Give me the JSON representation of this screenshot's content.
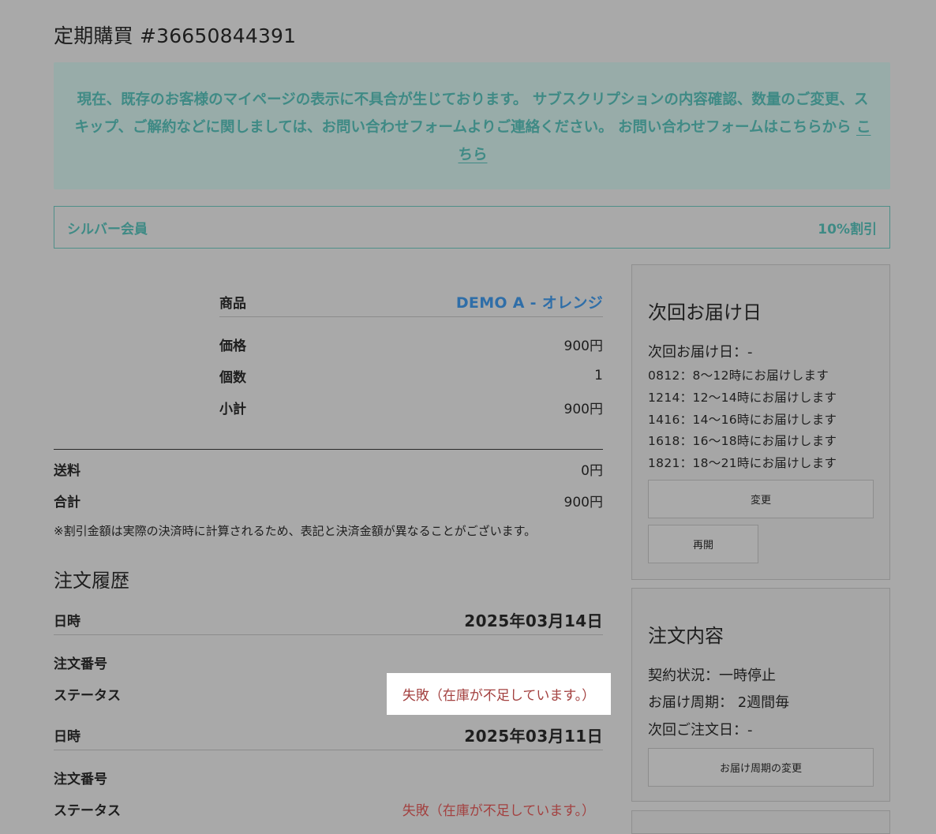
{
  "page": {
    "title": "定期購買 #36650844391"
  },
  "notice": {
    "text": "現在、既存のお客様のマイページの表示に不具合が生じております。 サブスクリプションの内容確認、数量のご変更、スキップ、ご解約などに関しましては、お問い合わせフォームよりご連絡ください。 お問い合わせフォームはこちらから",
    "link_label": "こちら"
  },
  "membership": {
    "tier": "シルバー会員",
    "discount": "10%割引"
  },
  "product": {
    "label": "商品",
    "name": "DEMO A - オレンジ",
    "price_label": "価格",
    "price": "900円",
    "qty_label": "個数",
    "qty": "1",
    "subtotal_label": "小計",
    "subtotal": "900円"
  },
  "totals": {
    "shipping_label": "送料",
    "shipping": "0円",
    "total_label": "合計",
    "total": "900円",
    "note": "※割引金額は実際の決済時に計算されるため、表記と決済金額が異なることがございます。"
  },
  "history": {
    "heading": "注文履歴",
    "entries": [
      {
        "date_label": "日時",
        "date": "2025年03月14日",
        "order_no_label": "注文番号",
        "order_no": "",
        "status_label": "ステータス",
        "status": "失敗（在庫が不足しています。）"
      },
      {
        "date_label": "日時",
        "date": "2025年03月11日",
        "order_no_label": "注文番号",
        "order_no": "",
        "status_label": "ステータス",
        "status": "失敗（在庫が不足しています。）"
      }
    ]
  },
  "next_delivery": {
    "heading": "次回お届け日",
    "date_line": "次回お届け日：-",
    "slots": [
      "0812：8〜12時にお届けします",
      "1214：12〜14時にお届けします",
      "1416：14〜16時にお届けします",
      "1618：16〜18時にお届けします",
      "1821：18〜21時にお届けします"
    ],
    "change_button": "変更",
    "resume_button": "再開"
  },
  "order_details": {
    "heading": "注文内容",
    "status_line": "契約状況：一時停止",
    "cycle_line": "お届け周期： 2週間毎",
    "next_order_line": "次回ご注文日：-",
    "change_cycle_button": "お届け周期の変更"
  },
  "colors": {
    "overlay_bg": "#a9a9a9",
    "accent_teal": "#3f8a85",
    "link_blue": "#2f6ea8",
    "error_red": "#a34140"
  }
}
